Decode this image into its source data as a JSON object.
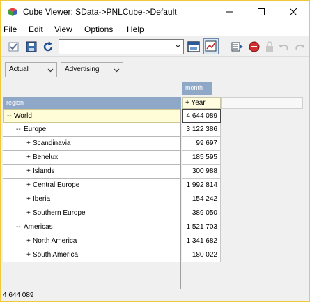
{
  "window": {
    "title": "Cube Viewer: SData->PNLCube->Default"
  },
  "menu": [
    "File",
    "Edit",
    "View",
    "Options",
    "Help"
  ],
  "toolbar": {
    "view_combo_value": ""
  },
  "filters": [
    {
      "label": "Actual"
    },
    {
      "label": "Advertising"
    }
  ],
  "grid": {
    "column_dimension": "month",
    "row_dimension": "region",
    "column_header": "+ Year",
    "rows": [
      {
        "prefix": "--",
        "label": "World",
        "value": "4 644 089"
      },
      {
        "prefix": "--",
        "label": "Europe",
        "value": "3 122 386"
      },
      {
        "prefix": "+",
        "label": "Scandinavia",
        "value": "99 697"
      },
      {
        "prefix": "+",
        "label": "Benelux",
        "value": "185 595"
      },
      {
        "prefix": "+",
        "label": "Islands",
        "value": "300 988"
      },
      {
        "prefix": "+",
        "label": "Central Europe",
        "value": "1 992 814"
      },
      {
        "prefix": "+",
        "label": "Iberia",
        "value": "154 242"
      },
      {
        "prefix": "+",
        "label": "Southern Europe",
        "value": "389 050"
      },
      {
        "prefix": "--",
        "label": "Americas",
        "value": "1 521 703"
      },
      {
        "prefix": "+",
        "label": "North America",
        "value": "1 341 682"
      },
      {
        "prefix": "+",
        "label": "South America",
        "value": "180 022"
      }
    ]
  },
  "status": {
    "text": "4 644 089"
  },
  "colors": {
    "accent_header": "#8fa8c8",
    "selection": "#fffcd8",
    "window_border": "#f0c838"
  }
}
